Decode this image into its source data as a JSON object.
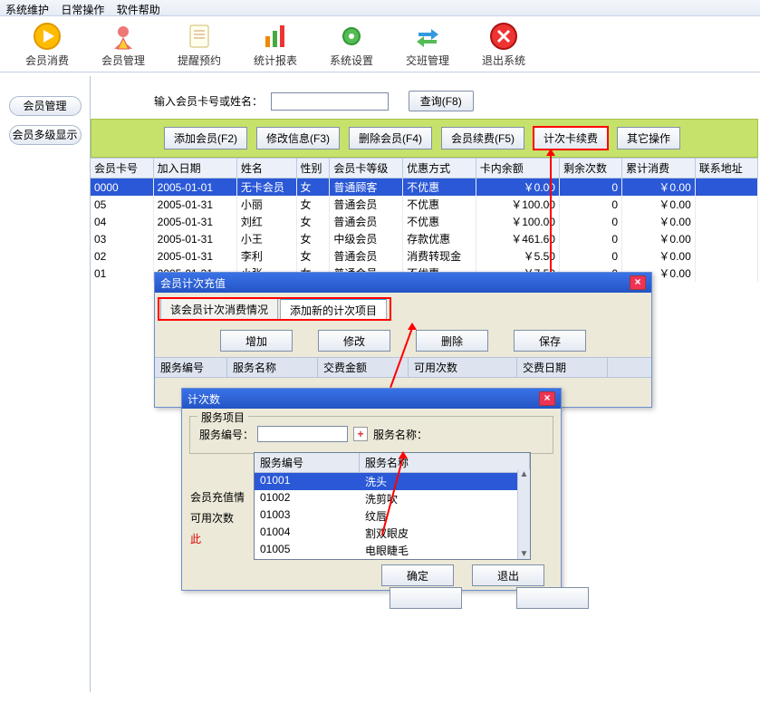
{
  "menu": {
    "sys": "系统维护",
    "daily": "日常操作",
    "help": "软件帮助"
  },
  "toolbar": [
    {
      "id": "consume",
      "label": "会员消费",
      "icon": "play"
    },
    {
      "id": "manage",
      "label": "会员管理",
      "icon": "person"
    },
    {
      "id": "remind",
      "label": "提醒预约",
      "icon": "note"
    },
    {
      "id": "stats",
      "label": "统计报表",
      "icon": "chart"
    },
    {
      "id": "settings",
      "label": "系统设置",
      "icon": "gear"
    },
    {
      "id": "shift",
      "label": "交班管理",
      "icon": "swap"
    },
    {
      "id": "exit",
      "label": "退出系统",
      "icon": "close"
    }
  ],
  "left": {
    "manage": "会员管理",
    "multi": "会员多级显示"
  },
  "search": {
    "label": "输入会员卡号或姓名：",
    "placeholder": "",
    "query_btn": "查询(F8)"
  },
  "ops": {
    "add": "添加会员(F2)",
    "edit": "修改信息(F3)",
    "del": "删除会员(F4)",
    "renew": "会员续费(F5)",
    "count": "计次卡续费",
    "other": "其它操作"
  },
  "grid": {
    "headers": [
      "会员卡号",
      "加入日期",
      "姓名",
      "性别",
      "会员卡等级",
      "优惠方式",
      "卡内余额",
      "剩余次数",
      "累计消费",
      "联系地址"
    ],
    "rows": [
      [
        "0000",
        "2005-01-01",
        "无卡会员",
        "女",
        "普通顾客",
        "不优惠",
        "￥0.00",
        "0",
        "￥0.00",
        ""
      ],
      [
        "05",
        "2005-01-31",
        "小丽",
        "女",
        "普通会员",
        "不优惠",
        "￥100.00",
        "0",
        "￥0.00",
        ""
      ],
      [
        "04",
        "2005-01-31",
        "刘红",
        "女",
        "普通会员",
        "不优惠",
        "￥100.00",
        "0",
        "￥0.00",
        ""
      ],
      [
        "03",
        "2005-01-31",
        "小王",
        "女",
        "中级会员",
        "存款优惠",
        "￥461.60",
        "0",
        "￥0.00",
        ""
      ],
      [
        "02",
        "2005-01-31",
        "李利",
        "女",
        "普通会员",
        "消费转现金",
        "￥5.50",
        "0",
        "￥0.00",
        ""
      ],
      [
        "01",
        "2005-01-31",
        "小张",
        "女",
        "普通会员",
        "不优惠",
        "￥7.50",
        "0",
        "￥0.00",
        ""
      ]
    ]
  },
  "dlg1": {
    "title": "会员计次充值",
    "tab1": "该会员计次消费情况",
    "tab2": "添加新的计次项目",
    "btn_add": "增加",
    "btn_edit": "修改",
    "btn_del": "删除",
    "btn_save": "保存",
    "sub_headers": [
      "服务编号",
      "服务名称",
      "交费金额",
      "可用次数",
      "交费日期"
    ]
  },
  "dlg2": {
    "title": "计次数",
    "group": "服务项目",
    "svc_no_label": "服务编号：",
    "svc_name_label": "服务名称：",
    "left_label1": "会员充值情",
    "left_label2": "可用次数",
    "note": "此",
    "btn_ok": "确定",
    "btn_exit": "退出"
  },
  "dropdown": {
    "hdr1": "服务编号",
    "hdr2": "服务名称",
    "rows": [
      [
        "01001",
        "洗头"
      ],
      [
        "01002",
        "洗剪吹"
      ],
      [
        "01003",
        "纹唇"
      ],
      [
        "01004",
        "割双眼皮"
      ],
      [
        "01005",
        "电眼睫毛"
      ]
    ],
    "sel_index": 0
  }
}
